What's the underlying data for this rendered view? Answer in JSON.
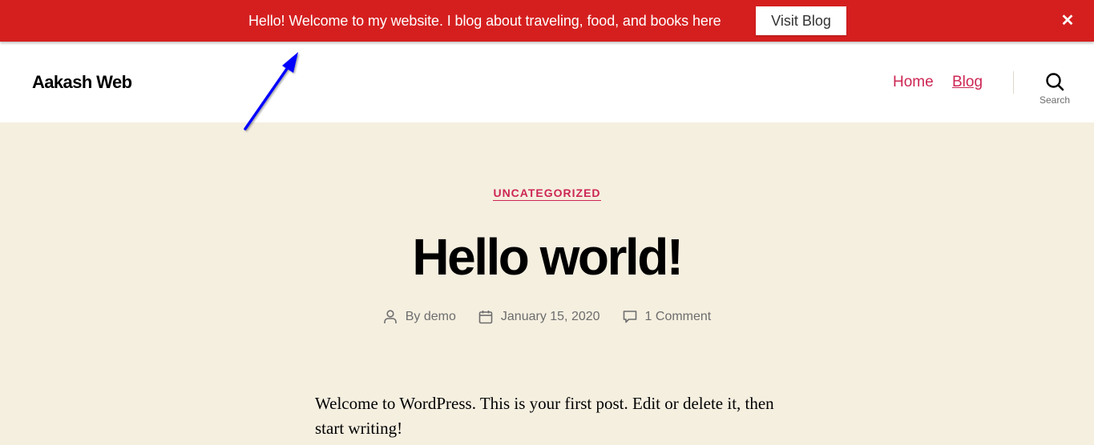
{
  "notice_bar": {
    "message": "Hello! Welcome to my website. I blog about traveling, food, and books here",
    "button_label": "Visit Blog",
    "close_icon": "close-icon",
    "background_color": "#d51f1f"
  },
  "header": {
    "site_title": "Aakash Web",
    "nav": [
      {
        "label": "Home"
      },
      {
        "label": "Blog"
      }
    ],
    "search": {
      "icon": "search-icon",
      "label": "Search"
    },
    "accent_color": "#cd2653"
  },
  "post": {
    "category": "UNCATEGORIZED",
    "title": "Hello world!",
    "meta": {
      "author": "By demo",
      "date": "January 15, 2020",
      "comments": "1 Comment"
    },
    "body": "Welcome to WordPress. This is your first post. Edit or delete it, then start writing!"
  },
  "annotation": {
    "type": "arrow",
    "color": "#0000ff",
    "points_to": "notice-bar"
  }
}
